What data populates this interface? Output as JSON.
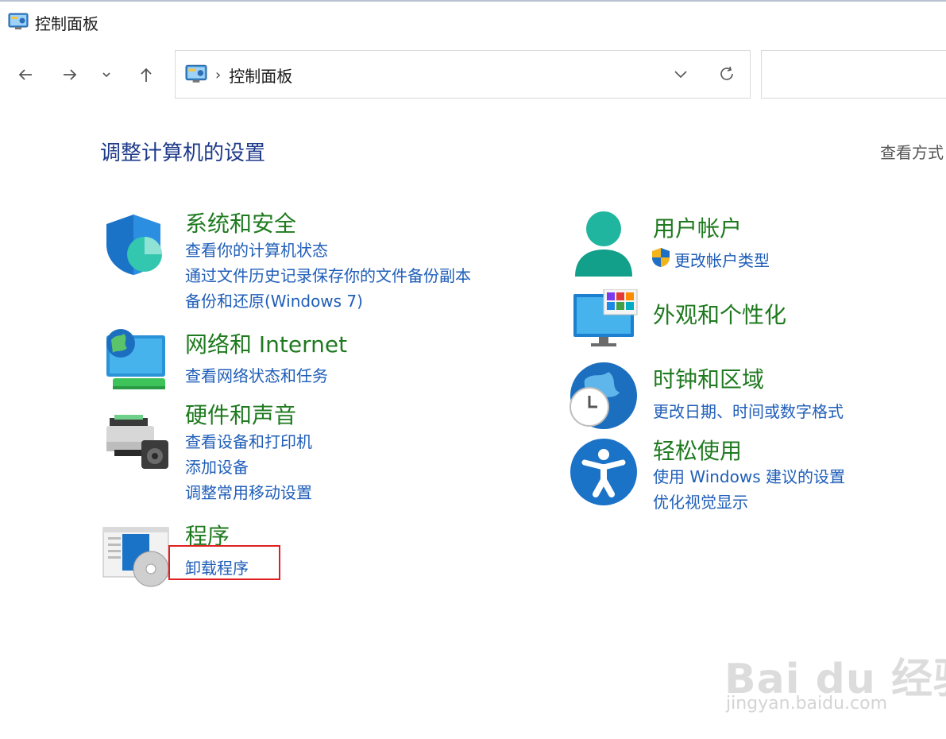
{
  "window": {
    "title": "控制面板"
  },
  "address": {
    "breadcrumb": "控制面板"
  },
  "main": {
    "heading": "调整计算机的设置",
    "view_by": "查看方式"
  },
  "categories": [
    {
      "title": "系统和安全",
      "links": [
        "查看你的计算机状态",
        "通过文件历史记录保存你的文件备份副本",
        "备份和还原(Windows 7)"
      ]
    },
    {
      "title": "网络和 Internet",
      "links": [
        "查看网络状态和任务"
      ]
    },
    {
      "title": "硬件和声音",
      "links": [
        "查看设备和打印机",
        "添加设备",
        "调整常用移动设置"
      ]
    },
    {
      "title": "程序",
      "links": [
        "卸载程序"
      ]
    },
    {
      "title": "用户帐户",
      "links": [
        "更改帐户类型"
      ]
    },
    {
      "title": "外观和个性化",
      "links": []
    },
    {
      "title": "时钟和区域",
      "links": [
        "更改日期、时间或数字格式"
      ]
    },
    {
      "title": "轻松使用",
      "links": [
        "使用 Windows 建议的设置",
        "优化视觉显示"
      ]
    }
  ],
  "watermark": {
    "brand": "Bai du 经验",
    "url": "jingyan.baidu.com"
  },
  "colors": {
    "category": "#1f7a1f",
    "link": "#1f5eb8",
    "heading": "#1e3a8a",
    "highlight": "#e02020"
  }
}
